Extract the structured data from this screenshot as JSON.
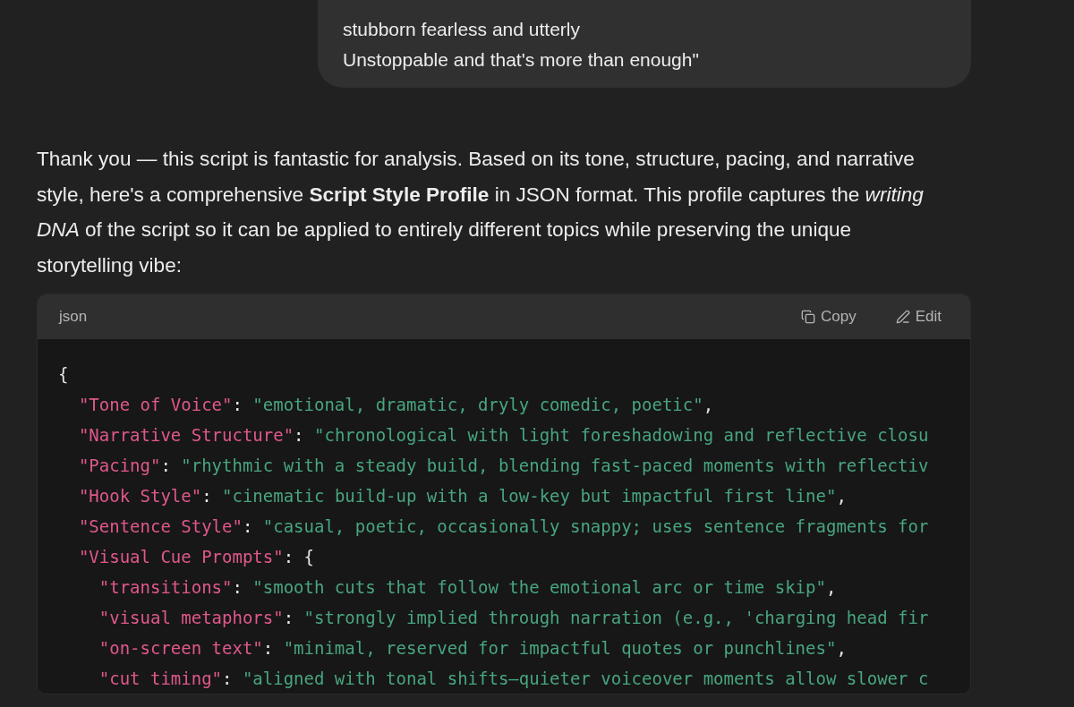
{
  "user_message": {
    "lines": [
      "stubborn fearless and utterly",
      "Unstoppable and that's more than enough\""
    ]
  },
  "assistant_reply": {
    "text": "Thank you — this script is fantastic for analysis. Based on its tone, structure, pacing, and narrative style, here's a comprehensive **Script Style Profile** in JSON format. This profile captures the *writing DNA* of the script so it can be applied to entirely different topics while preserving the unique storytelling vibe:"
  },
  "code_block": {
    "language": "json",
    "actions": [
      {
        "kind": "copy",
        "label": "Copy"
      },
      {
        "kind": "edit",
        "label": "Edit"
      }
    ],
    "lines": [
      [
        {
          "kind": "punct",
          "text": "{"
        }
      ],
      [
        {
          "kind": "key",
          "text": "  \"Tone of Voice\""
        },
        {
          "kind": "punct",
          "text": ": "
        },
        {
          "kind": "string",
          "text": "\"emotional, dramatic, dryly comedic, poetic\""
        },
        {
          "kind": "punct",
          "text": ","
        }
      ],
      [
        {
          "kind": "key",
          "text": "  \"Narrative Structure\""
        },
        {
          "kind": "punct",
          "text": ": "
        },
        {
          "kind": "string",
          "text": "\"chronological with light foreshadowing and reflective closu"
        }
      ],
      [
        {
          "kind": "key",
          "text": "  \"Pacing\""
        },
        {
          "kind": "punct",
          "text": ": "
        },
        {
          "kind": "string",
          "text": "\"rhythmic with a steady build, blending fast-paced moments with reflectiv"
        }
      ],
      [
        {
          "kind": "key",
          "text": "  \"Hook Style\""
        },
        {
          "kind": "punct",
          "text": ": "
        },
        {
          "kind": "string",
          "text": "\"cinematic build-up with a low-key but impactful first line\""
        },
        {
          "kind": "punct",
          "text": ","
        }
      ],
      [
        {
          "kind": "key",
          "text": "  \"Sentence Style\""
        },
        {
          "kind": "punct",
          "text": ": "
        },
        {
          "kind": "string",
          "text": "\"casual, poetic, occasionally snappy; uses sentence fragments for"
        }
      ],
      [
        {
          "kind": "key",
          "text": "  \"Visual Cue Prompts\""
        },
        {
          "kind": "punct",
          "text": ": {"
        }
      ],
      [
        {
          "kind": "key",
          "text": "    \"transitions\""
        },
        {
          "kind": "punct",
          "text": ": "
        },
        {
          "kind": "string",
          "text": "\"smooth cuts that follow the emotional arc or time skip\""
        },
        {
          "kind": "punct",
          "text": ","
        }
      ],
      [
        {
          "kind": "key",
          "text": "    \"visual metaphors\""
        },
        {
          "kind": "punct",
          "text": ": "
        },
        {
          "kind": "string",
          "text": "\"strongly implied through narration (e.g., 'charging head fir"
        }
      ],
      [
        {
          "kind": "key",
          "text": "    \"on-screen text\""
        },
        {
          "kind": "punct",
          "text": ": "
        },
        {
          "kind": "string",
          "text": "\"minimal, reserved for impactful quotes or punchlines\""
        },
        {
          "kind": "punct",
          "text": ","
        }
      ],
      [
        {
          "kind": "key",
          "text": "    \"cut timing\""
        },
        {
          "kind": "punct",
          "text": ": "
        },
        {
          "kind": "string",
          "text": "\"aligned with tonal shifts—quieter voiceover moments allow slower c"
        }
      ]
    ]
  }
}
